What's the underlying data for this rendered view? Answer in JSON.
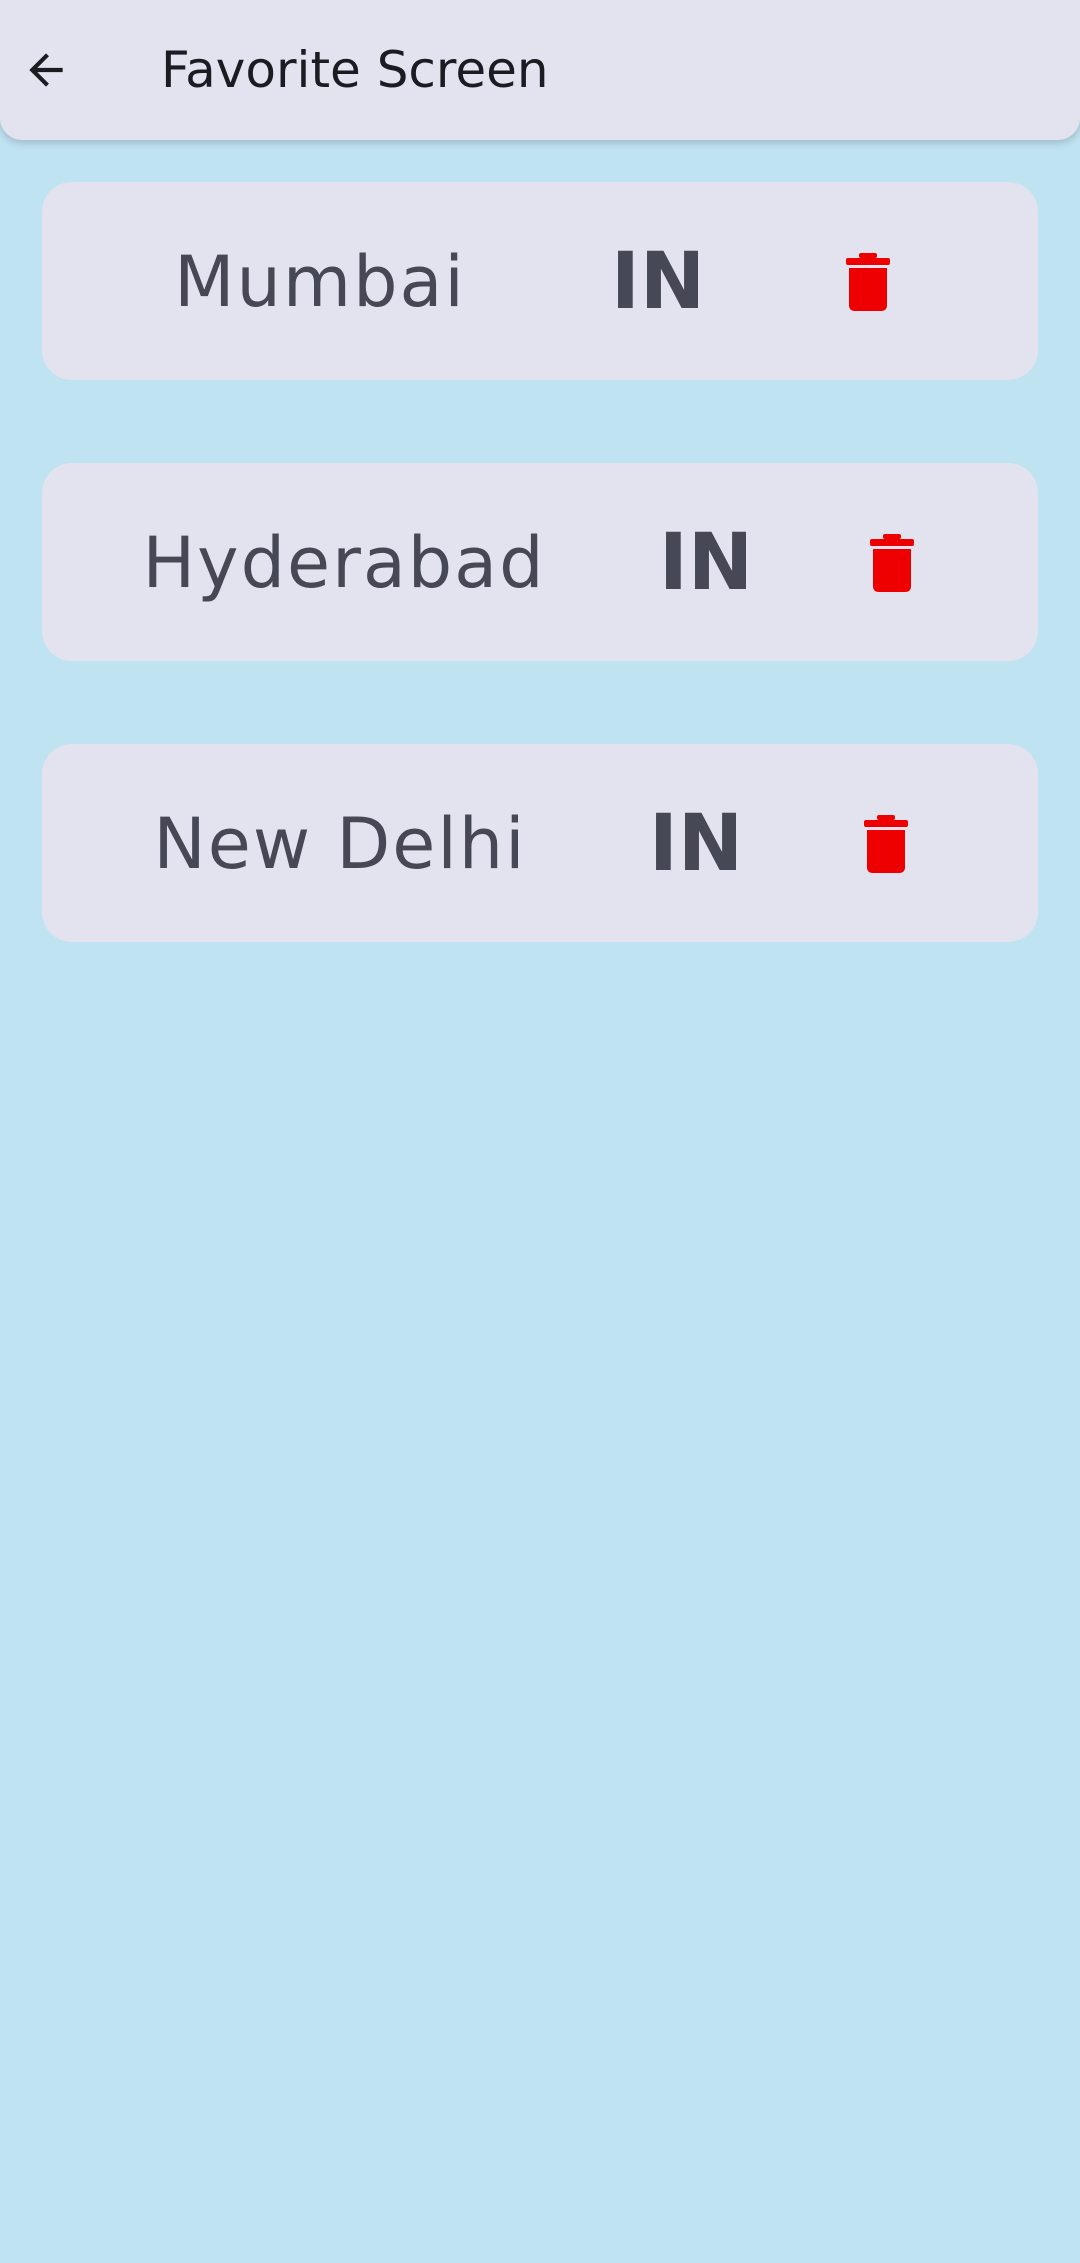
{
  "header": {
    "title": "Favorite Screen",
    "back_icon": "arrow-back-icon"
  },
  "favorites": [
    {
      "city": "Mumbai",
      "country": "IN",
      "delete_icon": "trash-icon"
    },
    {
      "city": "Hyderabad",
      "country": "IN",
      "delete_icon": "trash-icon"
    },
    {
      "city": "New Delhi",
      "country": "IN",
      "delete_icon": "trash-icon"
    }
  ],
  "colors": {
    "background": "#c0e3f2",
    "surface": "#e2e3ee",
    "text": "#474856",
    "title_text": "#1b1b22",
    "delete": "#ee0000"
  }
}
